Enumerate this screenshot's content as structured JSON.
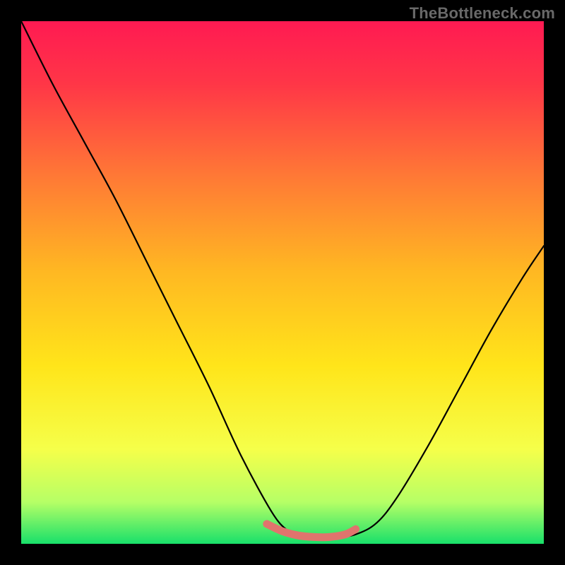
{
  "watermark": "TheBottleneck.com",
  "chart_data": {
    "type": "line",
    "title": "",
    "xlabel": "",
    "ylabel": "",
    "xlim": [
      0,
      1
    ],
    "ylim": [
      0,
      1
    ],
    "background_gradient": {
      "stops": [
        {
          "offset": 0.0,
          "color": "#ff1a52"
        },
        {
          "offset": 0.12,
          "color": "#ff3647"
        },
        {
          "offset": 0.3,
          "color": "#ff7a35"
        },
        {
          "offset": 0.48,
          "color": "#ffb822"
        },
        {
          "offset": 0.66,
          "color": "#ffe51a"
        },
        {
          "offset": 0.82,
          "color": "#f5ff4a"
        },
        {
          "offset": 0.92,
          "color": "#b6ff66"
        },
        {
          "offset": 1.0,
          "color": "#18e06a"
        }
      ]
    },
    "series": [
      {
        "name": "bottleneck-curve",
        "stroke": "#000000",
        "stroke_width": 2.2,
        "x": [
          0.0,
          0.06,
          0.12,
          0.18,
          0.24,
          0.3,
          0.36,
          0.42,
          0.48,
          0.51,
          0.53,
          0.56,
          0.6,
          0.64,
          0.68,
          0.72,
          0.78,
          0.84,
          0.9,
          0.96,
          1.0
        ],
        "y": [
          1.0,
          0.88,
          0.77,
          0.66,
          0.54,
          0.42,
          0.3,
          0.17,
          0.06,
          0.025,
          0.015,
          0.012,
          0.012,
          0.018,
          0.04,
          0.09,
          0.19,
          0.3,
          0.41,
          0.51,
          0.57
        ]
      },
      {
        "name": "optimal-zone-marker",
        "stroke": "#e0746d",
        "stroke_width": 11,
        "linecap": "round",
        "x": [
          0.47,
          0.5,
          0.53,
          0.56,
          0.59,
          0.62,
          0.64
        ],
        "y": [
          0.038,
          0.024,
          0.016,
          0.013,
          0.013,
          0.018,
          0.028
        ]
      }
    ]
  }
}
